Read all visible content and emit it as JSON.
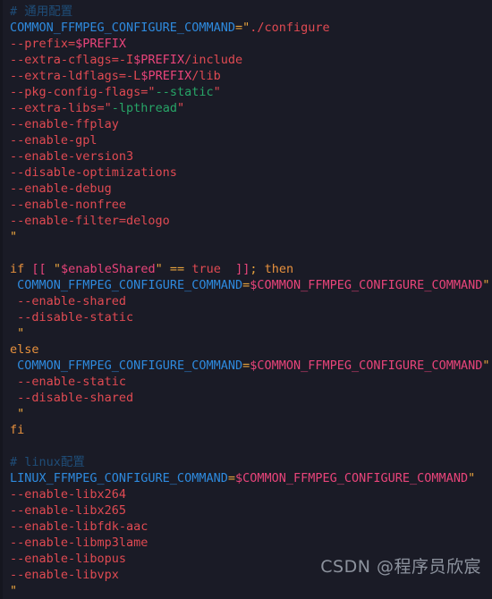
{
  "editor": {
    "language": "shell",
    "background_color": "#1a1b26",
    "gutter_color": "#15161f",
    "theme_colors": {
      "comment": "#1f4d78",
      "variable": "#2e8ade",
      "operator": "#e8a33d",
      "quote": "#e8a33d",
      "string": "#e04a52",
      "nested_string": "#27a567",
      "parameter": "#e8447a",
      "keyword": "#e8913d"
    }
  },
  "lines": [
    {
      "id": "l1",
      "text": "# 通用配置",
      "tokens": [
        {
          "t": "# 通用配置",
          "c": "t-comment"
        }
      ]
    },
    {
      "id": "l2",
      "text": "COMMON_FFMPEG_CONFIGURE_COMMAND=\"./configure",
      "tokens": [
        {
          "t": "COMMON_FFMPEG_CONFIGURE_COMMAND",
          "c": "t-var"
        },
        {
          "t": "=",
          "c": "t-op"
        },
        {
          "t": "\"",
          "c": "t-quote"
        },
        {
          "t": "./configure",
          "c": "t-str"
        }
      ]
    },
    {
      "id": "l3",
      "text": "--prefix=$PREFIX",
      "tokens": [
        {
          "t": "--prefix=",
          "c": "t-str"
        },
        {
          "t": "$PREFIX",
          "c": "t-param"
        }
      ]
    },
    {
      "id": "l4",
      "text": "--extra-cflags=-I$PREFIX/include",
      "tokens": [
        {
          "t": "--extra-cflags=-I",
          "c": "t-str"
        },
        {
          "t": "$PREFIX",
          "c": "t-param"
        },
        {
          "t": "/include",
          "c": "t-str"
        }
      ]
    },
    {
      "id": "l5",
      "text": "--extra-ldflags=-L$PREFIX/lib",
      "tokens": [
        {
          "t": "--extra-ldflags=-L",
          "c": "t-str"
        },
        {
          "t": "$PREFIX",
          "c": "t-param"
        },
        {
          "t": "/lib",
          "c": "t-str"
        }
      ]
    },
    {
      "id": "l6",
      "text": "--pkg-config-flags=\"--static\"",
      "tokens": [
        {
          "t": "--pkg-config-flags=\"",
          "c": "t-str"
        },
        {
          "t": "--static",
          "c": "t-green"
        },
        {
          "t": "\"",
          "c": "t-str"
        }
      ]
    },
    {
      "id": "l7",
      "text": "--extra-libs=\"-lpthread\"",
      "tokens": [
        {
          "t": "--extra-libs=\"",
          "c": "t-str"
        },
        {
          "t": "-lpthread",
          "c": "t-green"
        },
        {
          "t": "\"",
          "c": "t-str"
        }
      ]
    },
    {
      "id": "l8",
      "text": "--enable-ffplay",
      "tokens": [
        {
          "t": "--enable-ffplay",
          "c": "t-str"
        }
      ]
    },
    {
      "id": "l9",
      "text": "--enable-gpl",
      "tokens": [
        {
          "t": "--enable-gpl",
          "c": "t-str"
        }
      ]
    },
    {
      "id": "l10",
      "text": "--enable-version3",
      "tokens": [
        {
          "t": "--enable-version3",
          "c": "t-str"
        }
      ]
    },
    {
      "id": "l11",
      "text": "--disable-optimizations",
      "tokens": [
        {
          "t": "--disable-optimizations",
          "c": "t-str"
        }
      ]
    },
    {
      "id": "l12",
      "text": "--enable-debug",
      "tokens": [
        {
          "t": "--enable-debug",
          "c": "t-str"
        }
      ]
    },
    {
      "id": "l13",
      "text": "--enable-nonfree",
      "tokens": [
        {
          "t": "--enable-nonfree",
          "c": "t-str"
        }
      ]
    },
    {
      "id": "l14",
      "text": "--enable-filter=delogo",
      "tokens": [
        {
          "t": "--enable-filter=delogo",
          "c": "t-str"
        }
      ]
    },
    {
      "id": "l15",
      "text": "\"",
      "tokens": [
        {
          "t": "\"",
          "c": "t-quote"
        }
      ]
    },
    {
      "id": "l16",
      "text": "",
      "tokens": []
    },
    {
      "id": "l17",
      "text": "if [[ \"$enableShared\" == true  ]]; then",
      "tokens": [
        {
          "t": "if",
          "c": "t-kw"
        },
        {
          "t": " ",
          "c": "t-str"
        },
        {
          "t": "[[",
          "c": "t-bracket"
        },
        {
          "t": " ",
          "c": "t-str"
        },
        {
          "t": "\"",
          "c": "t-quote"
        },
        {
          "t": "$enableShared",
          "c": "t-param"
        },
        {
          "t": "\"",
          "c": "t-quote"
        },
        {
          "t": " ",
          "c": "t-str"
        },
        {
          "t": "==",
          "c": "t-op"
        },
        {
          "t": " ",
          "c": "t-str"
        },
        {
          "t": "true",
          "c": "t-true"
        },
        {
          "t": "  ",
          "c": "t-str"
        },
        {
          "t": "]]",
          "c": "t-bracket"
        },
        {
          "t": ";",
          "c": "t-semi"
        },
        {
          "t": " ",
          "c": "t-str"
        },
        {
          "t": "then",
          "c": "t-kw"
        }
      ]
    },
    {
      "id": "l18",
      "text": " COMMON_FFMPEG_CONFIGURE_COMMAND=$COMMON_FFMPEG_CONFIGURE_COMMAND\"",
      "tokens": [
        {
          "t": " ",
          "c": "t-str"
        },
        {
          "t": "COMMON_FFMPEG_CONFIGURE_COMMAND",
          "c": "t-var"
        },
        {
          "t": "=",
          "c": "t-op"
        },
        {
          "t": "$COMMON_FFMPEG_CONFIGURE_COMMAND",
          "c": "t-param"
        },
        {
          "t": "\"",
          "c": "t-quote"
        }
      ]
    },
    {
      "id": "l19",
      "text": " --enable-shared",
      "tokens": [
        {
          "t": " --enable-shared",
          "c": "t-str"
        }
      ]
    },
    {
      "id": "l20",
      "text": " --disable-static",
      "tokens": [
        {
          "t": " --disable-static",
          "c": "t-str"
        }
      ]
    },
    {
      "id": "l21",
      "text": " \"",
      "tokens": [
        {
          "t": " ",
          "c": "t-str"
        },
        {
          "t": "\"",
          "c": "t-quote"
        }
      ]
    },
    {
      "id": "l22",
      "text": "else",
      "tokens": [
        {
          "t": "else",
          "c": "t-kw"
        }
      ]
    },
    {
      "id": "l23",
      "text": " COMMON_FFMPEG_CONFIGURE_COMMAND=$COMMON_FFMPEG_CONFIGURE_COMMAND\"",
      "tokens": [
        {
          "t": " ",
          "c": "t-str"
        },
        {
          "t": "COMMON_FFMPEG_CONFIGURE_COMMAND",
          "c": "t-var"
        },
        {
          "t": "=",
          "c": "t-op"
        },
        {
          "t": "$COMMON_FFMPEG_CONFIGURE_COMMAND",
          "c": "t-param"
        },
        {
          "t": "\"",
          "c": "t-quote"
        }
      ]
    },
    {
      "id": "l24",
      "text": " --enable-static",
      "tokens": [
        {
          "t": " --enable-static",
          "c": "t-str"
        }
      ]
    },
    {
      "id": "l25",
      "text": " --disable-shared",
      "tokens": [
        {
          "t": " --disable-shared",
          "c": "t-str"
        }
      ]
    },
    {
      "id": "l26",
      "text": " \"",
      "tokens": [
        {
          "t": " ",
          "c": "t-str"
        },
        {
          "t": "\"",
          "c": "t-quote"
        }
      ]
    },
    {
      "id": "l27",
      "text": "fi",
      "tokens": [
        {
          "t": "fi",
          "c": "t-kw"
        }
      ]
    },
    {
      "id": "l28",
      "text": "",
      "tokens": []
    },
    {
      "id": "l29",
      "text": "# linux配置",
      "tokens": [
        {
          "t": "# linux配置",
          "c": "t-comment"
        }
      ]
    },
    {
      "id": "l30",
      "text": "LINUX_FFMPEG_CONFIGURE_COMMAND=$COMMON_FFMPEG_CONFIGURE_COMMAND\"",
      "tokens": [
        {
          "t": "LINUX_FFMPEG_CONFIGURE_COMMAND",
          "c": "t-var"
        },
        {
          "t": "=",
          "c": "t-op"
        },
        {
          "t": "$COMMON_FFMPEG_CONFIGURE_COMMAND",
          "c": "t-param"
        },
        {
          "t": "\"",
          "c": "t-quote"
        }
      ]
    },
    {
      "id": "l31",
      "text": "--enable-libx264",
      "tokens": [
        {
          "t": "--enable-libx264",
          "c": "t-str"
        }
      ]
    },
    {
      "id": "l32",
      "text": "--enable-libx265",
      "tokens": [
        {
          "t": "--enable-libx265",
          "c": "t-str"
        }
      ]
    },
    {
      "id": "l33",
      "text": "--enable-libfdk-aac",
      "tokens": [
        {
          "t": "--enable-libfdk-aac",
          "c": "t-str"
        }
      ]
    },
    {
      "id": "l34",
      "text": "--enable-libmp3lame",
      "tokens": [
        {
          "t": "--enable-libmp3lame",
          "c": "t-str"
        }
      ]
    },
    {
      "id": "l35",
      "text": "--enable-libopus",
      "tokens": [
        {
          "t": "--enable-libopus",
          "c": "t-str"
        }
      ]
    },
    {
      "id": "l36",
      "text": "--enable-libvpx",
      "tokens": [
        {
          "t": "--enable-libvpx",
          "c": "t-str"
        }
      ]
    },
    {
      "id": "l37",
      "text": "\"",
      "tokens": [
        {
          "t": "\"",
          "c": "t-quote"
        }
      ]
    }
  ],
  "watermark": {
    "text": "CSDN @程序员欣宸"
  }
}
